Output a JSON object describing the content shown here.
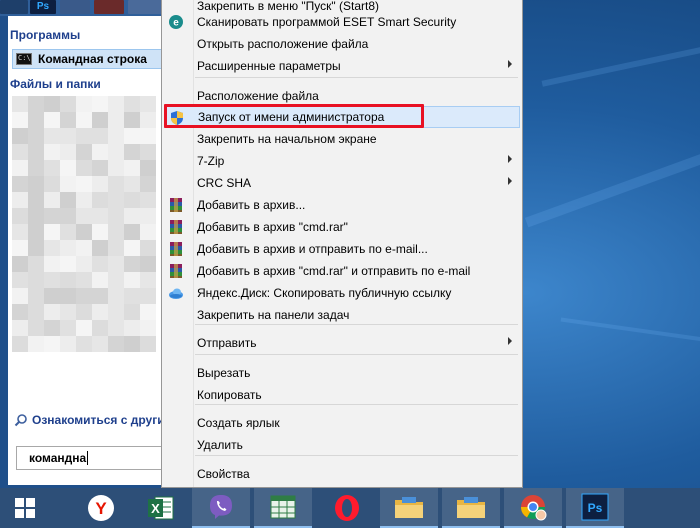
{
  "start_menu": {
    "programs_header": "Программы",
    "programs_result": "Командная строка",
    "files_header": "Файлы и папки",
    "see_more_link": "Ознакомиться с други",
    "search_value": "командна"
  },
  "context_menu": {
    "items": [
      {
        "label": "Закрепить в меню \"Пуск\" (Start8)",
        "icon": "none",
        "submenu": false
      },
      {
        "label": "Сканировать программой ESET Smart Security",
        "icon": "eset-icon",
        "submenu": false
      },
      {
        "label": "Открыть расположение файла",
        "icon": "none",
        "submenu": false
      },
      {
        "label": "Расширенные параметры",
        "icon": "none",
        "submenu": true
      },
      {
        "label": "Расположение файла",
        "icon": "none",
        "submenu": false
      },
      {
        "label": "Запуск от имени администратора",
        "icon": "uac-shield-icon",
        "submenu": false,
        "highlighted": true
      },
      {
        "label": "Закрепить на начальном экране",
        "icon": "none",
        "submenu": false
      },
      {
        "label": "7-Zip",
        "icon": "none",
        "submenu": true
      },
      {
        "label": "CRC SHA",
        "icon": "none",
        "submenu": true
      },
      {
        "label": "Добавить в архив...",
        "icon": "winrar-icon",
        "submenu": false
      },
      {
        "label": "Добавить в архив \"cmd.rar\"",
        "icon": "winrar-icon",
        "submenu": false
      },
      {
        "label": "Добавить в архив и отправить по e-mail...",
        "icon": "winrar-icon",
        "submenu": false
      },
      {
        "label": "Добавить в архив \"cmd.rar\" и отправить по e-mail",
        "icon": "winrar-icon",
        "submenu": false
      },
      {
        "label": "Яндекс.Диск: Скопировать публичную ссылку",
        "icon": "yandex-disk-icon",
        "submenu": false
      },
      {
        "label": "Закрепить на панели задач",
        "icon": "none",
        "submenu": false
      },
      {
        "label": "Отправить",
        "icon": "none",
        "submenu": true
      },
      {
        "label": "Вырезать",
        "icon": "none",
        "submenu": false
      },
      {
        "label": "Копировать",
        "icon": "none",
        "submenu": false
      },
      {
        "label": "Создать ярлык",
        "icon": "none",
        "submenu": false
      },
      {
        "label": "Удалить",
        "icon": "none",
        "submenu": false
      },
      {
        "label": "Свойства",
        "icon": "none",
        "submenu": false
      }
    ]
  },
  "taskbar": {
    "items": [
      {
        "name": "windows-start-icon"
      },
      {
        "name": "yandex-browser-icon"
      },
      {
        "name": "excel-icon"
      },
      {
        "name": "viber-icon"
      },
      {
        "name": "excel-file-icon"
      },
      {
        "name": "opera-icon"
      },
      {
        "name": "file-explorer-icon"
      },
      {
        "name": "file-explorer-icon"
      },
      {
        "name": "chrome-icon"
      },
      {
        "name": "photoshop-icon"
      }
    ],
    "ps_label": "Ps",
    "excel_label": "X"
  },
  "colors": {
    "highlight_border": "#e81123",
    "menu_hover": "#dbeafb",
    "taskbar": "#2d4f78"
  }
}
